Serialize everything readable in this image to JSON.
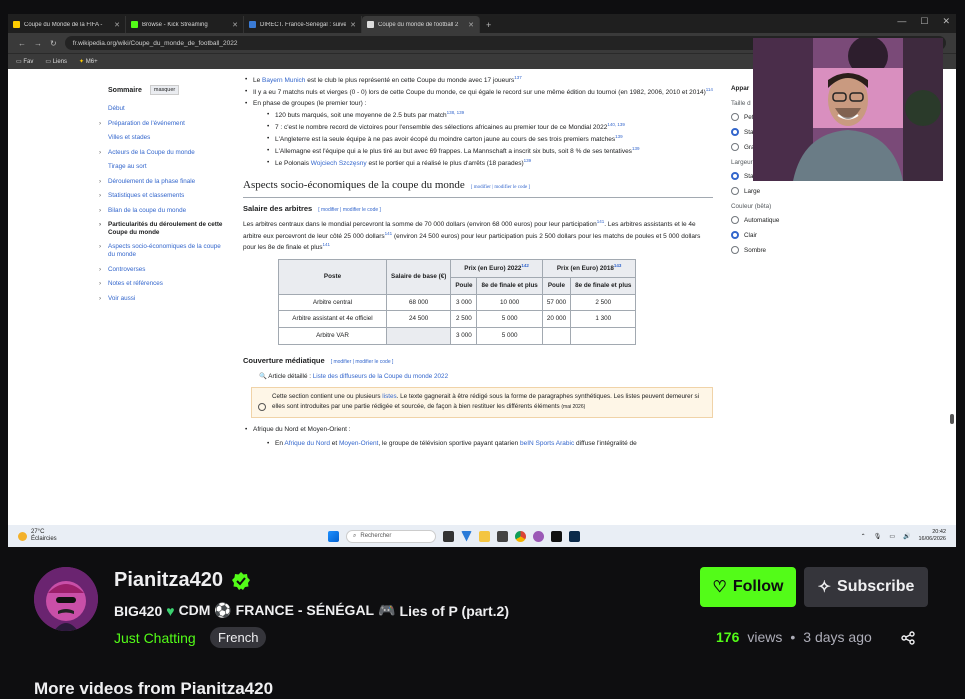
{
  "browser": {
    "tabs": [
      {
        "label": "Coupe du Monde de la FIFA - ",
        "color": "#ffcc00"
      },
      {
        "label": "Browse - Kick Streaming",
        "color": "#53fc18"
      },
      {
        "label": "DIRECT. France-Sénégal : suive",
        "color": "#3a7bd5"
      },
      {
        "label": "Coupe du monde de football 2",
        "color": "#dddddd"
      }
    ],
    "new_tab": "+",
    "url": "fr.wikipedia.org/wiki/Coupe_du_monde_de_football_2022",
    "bookmarks": [
      "Fav",
      "Liens",
      "M6+"
    ]
  },
  "toc": {
    "title": "Sommaire",
    "hide": "masquer",
    "items": [
      {
        "label": "Début",
        "chev": ""
      },
      {
        "label": "Préparation de l'événement",
        "chev": "›"
      },
      {
        "label": "Villes et stades",
        "chev": ""
      },
      {
        "label": "Acteurs de la Coupe du monde",
        "chev": "›"
      },
      {
        "label": "Tirage au sort",
        "chev": ""
      },
      {
        "label": "Déroulement de la phase finale",
        "chev": "›"
      },
      {
        "label": "Statistiques et classements",
        "chev": "›"
      },
      {
        "label": "Bilan de la coupe du monde",
        "chev": "›"
      },
      {
        "label": "Particularités du déroulement de cette Coupe du monde",
        "chev": "›"
      },
      {
        "label": "Aspects socio-économiques de la coupe du monde",
        "chev": "›"
      },
      {
        "label": "Controverses",
        "chev": "›"
      },
      {
        "label": "Notes et références",
        "chev": "›"
      },
      {
        "label": "Voir aussi",
        "chev": "›"
      }
    ]
  },
  "article": {
    "bullets_top": {
      "b1_pre": "Le ",
      "b1_link": "Bayern Munich",
      "b1_post": " est le club le plus représenté en cette Coupe du monde avec 17 joueurs",
      "b1_ref": "137",
      "b2": "Il y a eu 7 matchs nuls et vierges (0 - 0) lors de cette Coupe du monde, ce qui égale le record sur une même édition du tournoi (en 1982, 2006, 2010 et 2014)",
      "b2_ref": "114",
      "b3": "En phase de groupes (le premier tour) :",
      "s1": "120 buts marqués, soit une moyenne de 2.5 buts par match",
      "s1_ref": "138, 139",
      "s2": "7 : c'est le nombre record de victoires pour l'ensemble des sélections africaines au premier tour de ce Mondial 2022",
      "s2_ref": "140, 139",
      "s3": "L'Angleterre est la seule équipe à ne pas avoir écopé du moindre carton jaune au cours de ses trois premiers matches",
      "s3_ref": "139",
      "s4": "L'Allemagne est l'équipe qui a le plus tiré au but avec 69 frappes. La Mannschaft a inscrit six buts, soit 8 % de ses tentatives",
      "s4_ref": "139",
      "s5_pre": "Le Polonais ",
      "s5_link": "Wojciech Szczęsny",
      "s5_post": " est le portier qui a réalisé le plus d'arrêts (18 parades)",
      "s5_ref": "139"
    },
    "h2": "Aspects socio-économiques de la coupe du monde",
    "edit_links": "[ modifier | modifier le code ]",
    "h3_salaire": "Salaire des arbitres",
    "salaire_text": "Les arbitres centraux dans le mondial percevront la somme de 70 000 dollars (environ 68 000 euros) pour leur participation",
    "salaire_ref1": "141",
    "salaire_text2": ". Les arbitres assistants et le 4e arbitre eux percevront de leur côté 25 000 dollars",
    "salaire_ref2": "141",
    "salaire_text3": " (environ 24 500 euros) pour leur participation puis 2 500 dollars pour les matchs de poules et 5 000 dollars pour les 8e de finale et plus",
    "salaire_ref3": "141",
    "table": {
      "h_poste": "Poste",
      "h_salaire": "Salaire de base (€)",
      "h_2022": "Prix (en Euro) 2022",
      "h_2022_ref": "142",
      "h_2018": "Prix (en Euro) 2018",
      "h_2018_ref": "143",
      "h_poule": "Poule",
      "h_8e": "8e de finale et plus",
      "rows": [
        [
          "Arbitre central",
          "68 000",
          "3 000",
          "10 000",
          "57 000",
          "2 500"
        ],
        [
          "Arbitre assistant et 4e officiel",
          "24 500",
          "2 500",
          "5 000",
          "20 000",
          "1 300"
        ],
        [
          "Arbitre VAR",
          "",
          "3 000",
          "5 000",
          "",
          ""
        ]
      ]
    },
    "h3_couverture": "Couverture médiatique",
    "hat_pre": "Article détaillé : ",
    "hat_link": "Liste des diffuseurs de la Coupe du monde 2022",
    "ambox_pre": "Cette section contient une ou plusieurs ",
    "ambox_link": "listes",
    "ambox_post": ". Le texte gagnerait à être rédigé sous la forme de paragraphes synthétiques. Les listes peuvent demeurer si elles sont introduites par une partie rédigée et sourcée, de façon à bien restituer les différents éléments",
    "ambox_date": "(mai 2026)",
    "b_afrique": "Afrique du Nord et Moyen-Orient :",
    "b_en_pre": "En ",
    "b_en_l1": "Afrique du Nord",
    "b_en_mid": " et ",
    "b_en_l2": "Moyen-Orient",
    "b_en_mid2": ", le groupe de télévision sportive payant qatarien ",
    "b_en_l3": "beIN Sports Arabic",
    "b_en_post": " diffuse l'intégralité de"
  },
  "appearance": {
    "title": "Appar",
    "taille": "Taille d",
    "sizes": [
      "Pet",
      "Sta",
      "Gra"
    ],
    "largeur": "Largeur",
    "widths": [
      "Standard",
      "Large"
    ],
    "couleur": "Couleur (bêta)",
    "colors": [
      "Automatique",
      "Clair",
      "Sombre"
    ]
  },
  "taskbar": {
    "temp": "27°C",
    "weather": "Éclaircies",
    "search": "Rechercher",
    "time": "20:42",
    "date": "16/06/2026"
  },
  "channel": {
    "name": "Pianitza420",
    "title_pre": "BIG420",
    "title_mid": " CDM ⚽ FRANCE - SÉNÉGAL ",
    "title_post": " Lies of P (part.2)",
    "category": "Just Chatting",
    "language": "French",
    "follow": "Follow",
    "subscribe": "Subscribe",
    "views_num": "176",
    "views_label": "views",
    "dot": "•",
    "age": "3 days ago",
    "more": "More videos from Pianitza420",
    "accent": "#53fc18"
  }
}
